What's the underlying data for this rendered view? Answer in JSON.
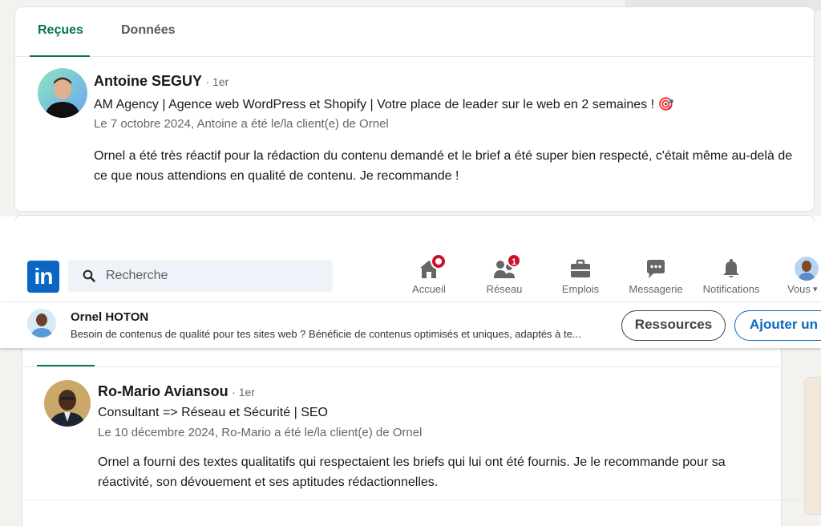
{
  "tabs": {
    "received": "Reçues",
    "given": "Données"
  },
  "top_recommendation": {
    "name": "Antoine SEGUY",
    "degree": "· 1er",
    "headline": "AM Agency | Agence web WordPress et Shopify | Votre place de leader sur le web en 2 semaines ! 🎯",
    "meta": "Le 7 octobre 2024, Antoine a été le/la client(e) de Ornel",
    "text": "Ornel a été très réactif pour la rédaction du contenu demandé et le brief a été super bien respecté, c'était même au-delà de ce que nous attendions en qualité de contenu. Je recommande !"
  },
  "navbar": {
    "logo": "in",
    "search_placeholder": "Recherche",
    "items": [
      {
        "label": "Accueil",
        "icon": "home-icon",
        "badge": ""
      },
      {
        "label": "Réseau",
        "icon": "network-icon",
        "badge": "1"
      },
      {
        "label": "Emplois",
        "icon": "briefcase-icon",
        "badge": ""
      },
      {
        "label": "Messagerie",
        "icon": "messaging-icon",
        "badge": ""
      },
      {
        "label": "Notifications",
        "icon": "bell-icon",
        "badge": ""
      },
      {
        "label": "Vous",
        "icon": "avatar-icon",
        "badge": ""
      }
    ]
  },
  "profile_bar": {
    "name": "Ornel HOTON",
    "description": "Besoin de contenus de qualité pour tes sites web ? Bénéficie de contenus optimisés et uniques, adaptés à te...",
    "resources_button": "Ressources",
    "add_button": "Ajouter un"
  },
  "bottom_recommendation": {
    "name": "Ro-Mario Aviansou",
    "degree": "· 1er",
    "headline": "Consultant => Réseau et Sécurité | SEO",
    "meta": "Le 10 décembre 2024, Ro-Mario a été le/la client(e) de Ornel",
    "text": "Ornel a fourni des textes qualitatifs qui respectaient les briefs qui lui ont été fournis. Je le recommande pour sa réactivité, son dévouement et ses aptitudes rédactionnelles."
  },
  "colors": {
    "accent_green": "#01754f",
    "linkedin_blue": "#0a66c2",
    "badge_red": "#cb112d"
  }
}
